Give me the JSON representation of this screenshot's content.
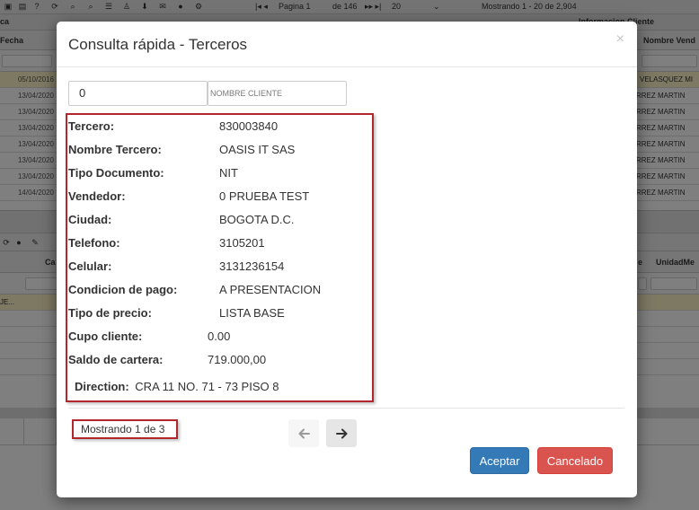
{
  "background": {
    "pager": {
      "page_label": "Pagina 1",
      "of_label": "de 146",
      "page_size": "20",
      "showing": "Mostrando 1 - 20 de 2,904"
    },
    "section_header": "Informacion Cliente",
    "columns": {
      "left_fragment": "ca",
      "fecha": "Fecha",
      "nombre_vendedor": "Nombre Vend"
    },
    "rows": [
      {
        "date": "05/10/2016",
        "name": "VELASQUEZ MI"
      },
      {
        "date": "13/04/2020",
        "name": "RREZ MARTIN"
      },
      {
        "date": "13/04/2020",
        "name": "RREZ MARTIN"
      },
      {
        "date": "13/04/2020",
        "name": "RREZ MARTIN"
      },
      {
        "date": "13/04/2020",
        "name": "RREZ MARTIN"
      },
      {
        "date": "13/04/2020",
        "name": "RREZ MARTIN"
      },
      {
        "date": "13/04/2020",
        "name": "RREZ MARTIN"
      },
      {
        "date": "14/04/2020",
        "name": "RREZ MARTIN"
      }
    ],
    "lower_grid": {
      "col_left": "Ca",
      "col_right_frag": "e",
      "col_unidad": "UnidadMe",
      "row1_text": "JE..."
    }
  },
  "modal": {
    "title": "Consulta rápida - Terceros",
    "close_glyph": "×",
    "search": {
      "code_value": "0",
      "name_placeholder": "NOMBRE CLIENTE"
    },
    "fields": [
      {
        "label": "Tercero:",
        "value": "830003840"
      },
      {
        "label": "Nombre Tercero:",
        "value": "OASIS IT SAS"
      },
      {
        "label": "Tipo Documento:",
        "value": "NIT"
      },
      {
        "label": "Vendedor:",
        "value": "0 PRUEBA TEST"
      },
      {
        "label": "Ciudad:",
        "value": "BOGOTA D.C."
      },
      {
        "label": "Telefono:",
        "value": "3105201"
      },
      {
        "label": "Celular:",
        "value": "3131236154"
      },
      {
        "label": "Condicion de pago:",
        "value": "A PRESENTACION"
      },
      {
        "label": "Tipo de precio:",
        "value": "LISTA BASE"
      },
      {
        "label": "Cupo cliente:",
        "value": "0.00"
      },
      {
        "label": "Saldo de cartera:",
        "value": "719.000,00"
      }
    ],
    "direction": {
      "label": "Direction:",
      "value": "CRA 11 NO. 71 - 73 PISO 8"
    },
    "showing": "Mostrando 1 de 3",
    "icons": {
      "prev": "arrow-left-icon",
      "next": "arrow-right-icon"
    },
    "buttons": {
      "accept": "Aceptar",
      "cancel": "Cancelado"
    },
    "colors": {
      "accept": "#337ab7",
      "cancel": "#d9534f",
      "highlight_border": "#b3262c"
    }
  }
}
